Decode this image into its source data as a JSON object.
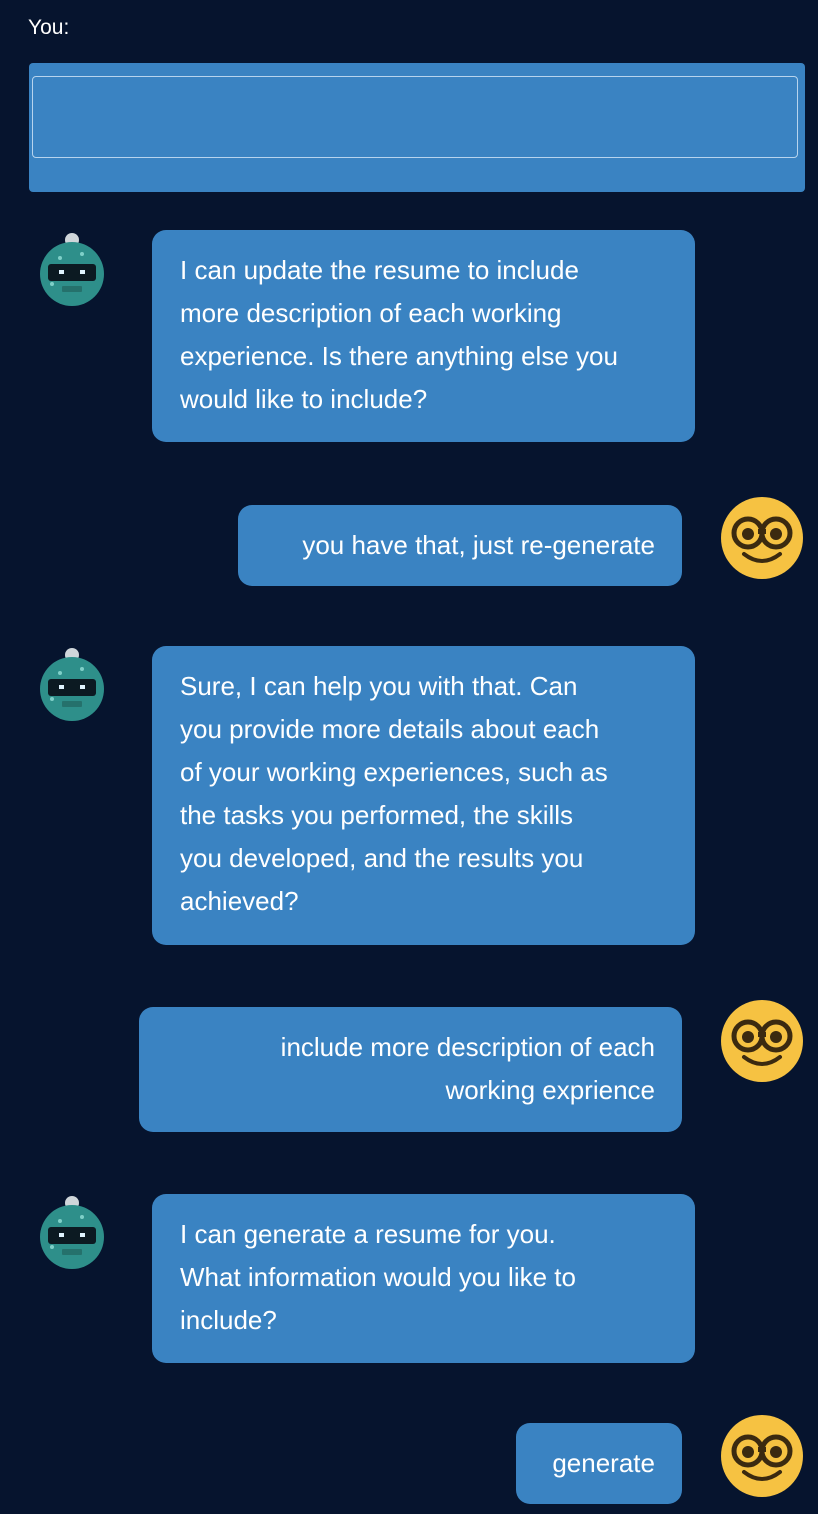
{
  "header": {
    "you_label": "You:"
  },
  "input": {
    "value": "",
    "placeholder": ""
  },
  "colors": {
    "background": "#06142e",
    "bubble": "#3a83c2",
    "bot_avatar": "#2e8f8a",
    "user_avatar": "#f6c242"
  },
  "messages": [
    {
      "role": "bot",
      "avatar_icon": "robot-icon",
      "lines": [
        "I can update the resume to include",
        "more description of each working",
        "experience. Is there anything else you",
        "would like to include?"
      ]
    },
    {
      "role": "user",
      "avatar_icon": "nerd-face-icon",
      "lines": [
        "you have that, just re-generate"
      ]
    },
    {
      "role": "bot",
      "avatar_icon": "robot-icon",
      "lines": [
        "Sure, I can help you with that. Can",
        "you provide more details about each",
        "of your working experiences, such as",
        "the tasks you performed, the skills",
        "you developed, and the results you",
        "achieved?"
      ]
    },
    {
      "role": "user",
      "avatar_icon": "nerd-face-icon",
      "lines": [
        "include more description of each",
        "working exprience"
      ]
    },
    {
      "role": "bot",
      "avatar_icon": "robot-icon",
      "lines": [
        "I can generate a resume for you.",
        "What information would you like to",
        "include?"
      ]
    },
    {
      "role": "user",
      "avatar_icon": "nerd-face-icon",
      "lines": [
        "generate"
      ]
    }
  ]
}
